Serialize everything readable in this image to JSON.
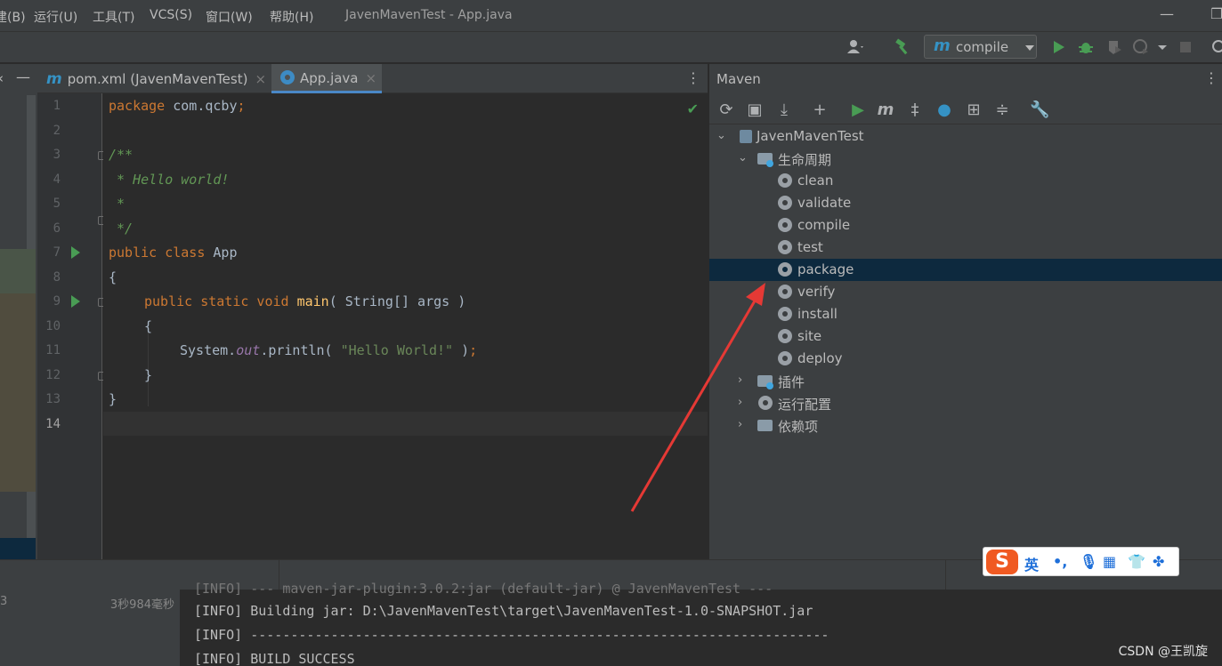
{
  "menubar": {
    "items": [
      "建(B)",
      "运行(U)",
      "工具(T)",
      "VCS(S)",
      "窗口(W)",
      "帮助(H)"
    ],
    "window_title": "JavenMavenTest - App.java"
  },
  "toolbar": {
    "run_config_label": "compile",
    "icons": [
      "user-icon",
      "hammer-icon",
      "maven-icon",
      "run-icon",
      "debug-icon",
      "coverage-icon",
      "profile-icon",
      "stop-icon",
      "search-icon"
    ]
  },
  "tabs": [
    {
      "label": "pom.xml (JavenMavenTest)",
      "icon": "maven-icon",
      "active": false
    },
    {
      "label": "App.java",
      "icon": "java-class-icon",
      "active": true
    }
  ],
  "editor": {
    "line_numbers": [
      "1",
      "2",
      "3",
      "4",
      "5",
      "6",
      "7",
      "8",
      "9",
      "10",
      "11",
      "12",
      "13",
      "14"
    ],
    "current_line": "14",
    "lines": {
      "l1_kw": "package",
      "l1_rest": " com.qcby",
      "l1_semi": ";",
      "l3": "/**",
      "l4": " * Hello world!",
      "l5": " *",
      "l6": " */",
      "l7_kw": "public class",
      "l7_rest": " App",
      "l8": "{",
      "l9_kw": "public static void",
      "l9_fn": "main",
      "l9_rest": "( String[] args )",
      "l10": "{",
      "l11_a": "System.",
      "l11_fld": "out",
      "l11_b": ".println( ",
      "l11_str": "\"Hello World!\"",
      "l11_c": " )",
      "l11_semi": ";",
      "l12": "}",
      "l13": "}"
    }
  },
  "maven": {
    "title": "Maven",
    "project": "JavenMavenTest",
    "lifecycle_label": "生命周期",
    "lifecycle": [
      "clean",
      "validate",
      "compile",
      "test",
      "package",
      "verify",
      "install",
      "site",
      "deploy"
    ],
    "selected": "package",
    "groups": [
      "插件",
      "运行配置",
      "依赖项"
    ]
  },
  "bottom": {
    "time_left": "3",
    "time_right": "3秒984毫秒",
    "console_lines": [
      "[INFO] --- maven-jar-plugin:3.0.2:jar (default-jar) @ JavenMavenTest ---",
      "[INFO] Building jar: D:\\JavenMavenTest\\target\\JavenMavenTest-1.0-SNAPSHOT.jar",
      "[INFO] ------------------------------------------------------------------------",
      "[INFO] BUILD SUCCESS"
    ]
  },
  "ime": {
    "logo": "S",
    "lang": "英",
    "punct": "•,"
  },
  "watermark": "CSDN @王凯旋",
  "colors": {
    "keyword": "#cc7832",
    "comment": "#629755",
    "function": "#ffc66d",
    "string": "#6a8759",
    "selection": "#0d293e",
    "arrow": "#e53935"
  }
}
